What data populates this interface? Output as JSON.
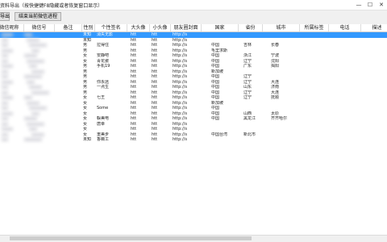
{
  "window": {
    "title": "资料导出（按快捷键F8隐藏或者恢复窗口显示）",
    "minimize": "—",
    "maximize": "☐",
    "close": "✕"
  },
  "toolbar": {
    "button1": "导出",
    "button2": "结束当前微信进程"
  },
  "table": {
    "columns": [
      "微信昵称",
      "微信号",
      "备注",
      "性别",
      "个性签名",
      "大头像",
      "小头像",
      "朋友圈封面",
      "国家",
      "省份",
      "城市",
      "所属标签",
      "电话",
      "描述"
    ],
    "rows": [
      {
        "gender": "未知",
        "sig": "消失无影",
        "big": "htt",
        "small": "htt",
        "cover": "http://s",
        "country": "",
        "province": "",
        "city": ""
      },
      {
        "gender": "未知",
        "sig": "",
        "big": "htt",
        "small": "htt",
        "cover": "http://s",
        "country": "",
        "province": "",
        "city": ""
      },
      {
        "gender": "男",
        "sig": "拉得住",
        "big": "htt",
        "small": "htt",
        "cover": "http://s",
        "country": "中国",
        "province": "吉林",
        "city": "长春"
      },
      {
        "gender": "男",
        "sig": "",
        "big": "htt",
        "small": "htt",
        "cover": "http://s",
        "country": "毛里求斯",
        "province": "",
        "city": ""
      },
      {
        "gender": "女",
        "sig": "安静吧",
        "big": "htt",
        "small": "htt",
        "cover": "http://s",
        "country": "中国",
        "province": "浙江",
        "city": "宁波"
      },
      {
        "gender": "女",
        "sig": "青花瓷",
        "big": "htt",
        "small": "htt",
        "cover": "http://s",
        "country": "中国",
        "province": "辽宁",
        "city": "沈阳"
      },
      {
        "gender": "男",
        "sig": "手机19",
        "big": "htt",
        "small": "htt",
        "cover": "http://s",
        "country": "中国",
        "province": "广东",
        "city": "揭阳"
      },
      {
        "gender": "男",
        "sig": "",
        "big": "htt",
        "small": "htt",
        "cover": "http://s",
        "country": "新加坡",
        "province": "",
        "city": ""
      },
      {
        "gender": "男",
        "sig": "",
        "big": "htt",
        "small": "htt",
        "cover": "http://s",
        "country": "中国",
        "province": "辽宁",
        "city": ""
      },
      {
        "gender": "男",
        "sig": "你永远",
        "big": "htt",
        "small": "htt",
        "cover": "http://s",
        "country": "中国",
        "province": "辽宁",
        "city": "大连"
      },
      {
        "gender": "男",
        "sig": "一点生",
        "big": "htt",
        "small": "htt",
        "cover": "http://s",
        "country": "中国",
        "province": "山东",
        "city": "济南"
      },
      {
        "gender": "男",
        "sig": "",
        "big": "htt",
        "small": "htt",
        "cover": "http://s",
        "country": "中国",
        "province": "辽宁",
        "city": "大连"
      },
      {
        "gender": "女",
        "sig": "七王",
        "big": "htt",
        "small": "htt",
        "cover": "http://s",
        "country": "中国",
        "province": "辽宁",
        "city": "抚顺"
      },
      {
        "gender": "女",
        "sig": "",
        "big": "htt",
        "small": "htt",
        "cover": "http://s",
        "country": "新加坡",
        "province": "",
        "city": ""
      },
      {
        "gender": "女",
        "sig": "Some",
        "big": "htt",
        "small": "htt",
        "cover": "http://s",
        "country": "中国",
        "province": "",
        "city": ""
      },
      {
        "gender": "女",
        "sig": "",
        "big": "htt",
        "small": "htt",
        "cover": "http://s",
        "country": "中国",
        "province": "山西",
        "city": "太原"
      },
      {
        "gender": "女",
        "sig": "躲美电",
        "big": "htt",
        "small": "htt",
        "cover": "http://s",
        "country": "中国",
        "province": "黑龙江",
        "city": "齐齐哈尔"
      },
      {
        "gender": "女",
        "sig": "唐幸",
        "big": "htt",
        "small": "htt",
        "cover": "http://s",
        "country": "",
        "province": "",
        "city": ""
      },
      {
        "gender": "女",
        "sig": "",
        "big": "htt",
        "small": "htt",
        "cover": "http://s",
        "country": "",
        "province": "",
        "city": ""
      },
      {
        "gender": "女",
        "sig": "重美步",
        "big": "htt",
        "small": "htt",
        "cover": "http://s",
        "country": "中国台湾",
        "province": "新北市",
        "city": ""
      },
      {
        "gender": "未知",
        "sig": "香薇工",
        "big": "htt",
        "small": "htt",
        "cover": "http://s",
        "country": "",
        "province": "",
        "city": ""
      }
    ]
  }
}
